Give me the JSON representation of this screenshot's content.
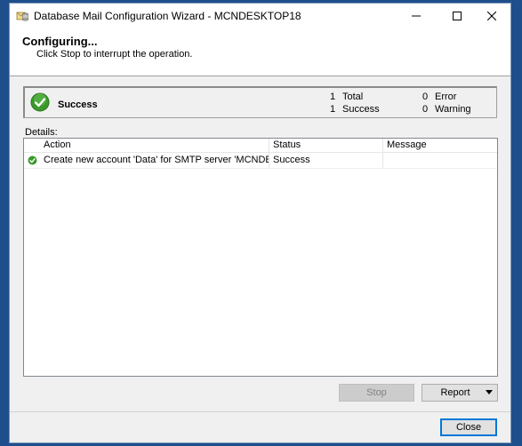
{
  "window": {
    "title": "Database Mail Configuration Wizard - MCNDESKTOP18",
    "minimize_icon": "minimize-icon",
    "maximize_icon": "maximize-icon",
    "close_icon": "close-icon"
  },
  "header": {
    "title": "Configuring...",
    "subtitle": "Click Stop to interrupt the operation."
  },
  "status": {
    "label": "Success",
    "total_count": "1",
    "total_label": "Total",
    "success_count": "1",
    "success_label": "Success",
    "error_count": "0",
    "error_label": "Error",
    "warning_count": "0",
    "warning_label": "Warning",
    "icon": "success-check-icon",
    "accent_color": "#3a9a2a"
  },
  "details": {
    "label": "Details:",
    "columns": [
      "Action",
      "Status",
      "Message"
    ],
    "rows": [
      {
        "action": "Create new account 'Data' for SMTP server 'MCNDESKT...",
        "status": "Success",
        "message": ""
      }
    ]
  },
  "buttons": {
    "stop": "Stop",
    "report": "Report",
    "close": "Close"
  }
}
